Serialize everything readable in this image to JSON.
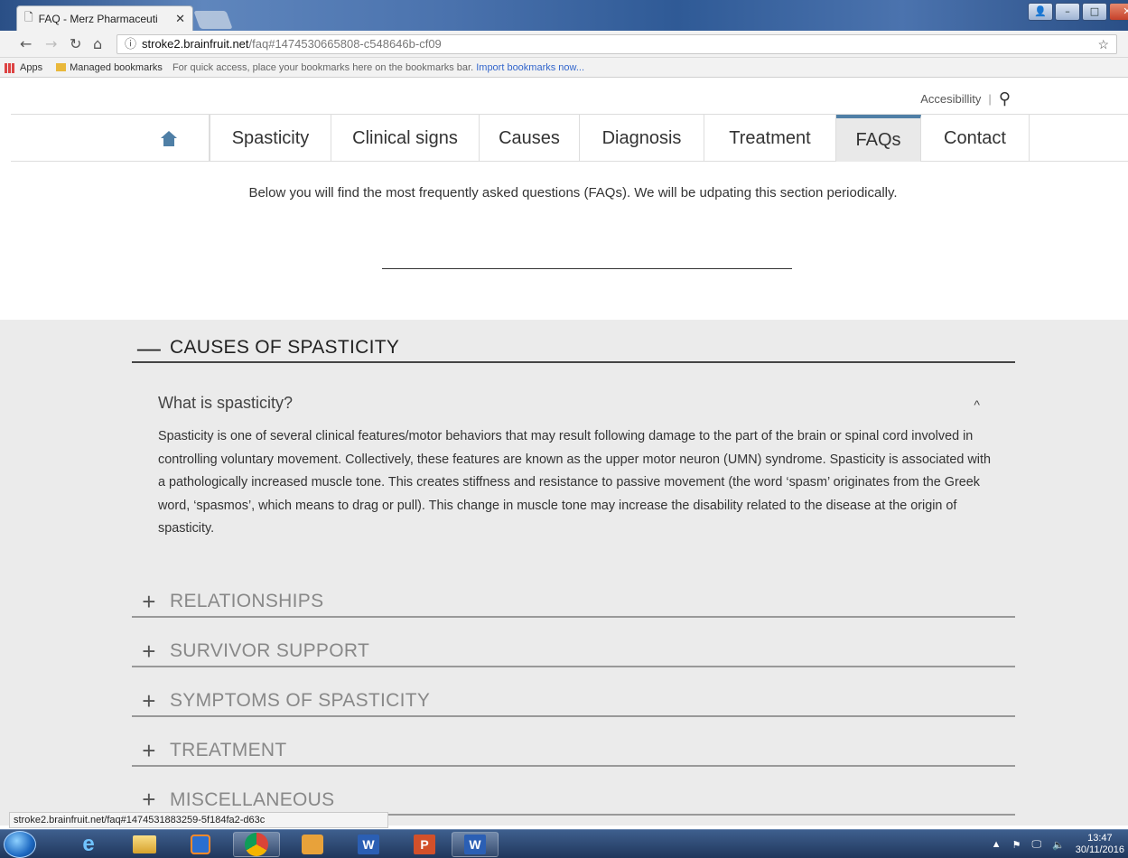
{
  "browser": {
    "tab_title": "FAQ - Merz Pharmaceuti",
    "tab_close": "✕",
    "url_host": "stroke2.brainfruit.net",
    "url_path": "/faq#1474530665808-c548646b-cf09",
    "bookmarks": {
      "apps": "Apps",
      "managed": "Managed bookmarks",
      "hint": "For quick access, place your bookmarks here on the bookmarks bar.",
      "import": "Import bookmarks now..."
    }
  },
  "utility": {
    "accessibility": "Accesibillity",
    "separator": "|"
  },
  "nav": {
    "items": [
      {
        "label": "Spasticity"
      },
      {
        "label": "Clinical signs"
      },
      {
        "label": "Causes"
      },
      {
        "label": "Diagnosis"
      },
      {
        "label": "Treatment"
      },
      {
        "label": "FAQs"
      },
      {
        "label": "Contact"
      }
    ],
    "active_color": "#4f7fa6"
  },
  "intro": "Below you will find the most frequently asked questions (FAQs). We will be udpating this section periodically.",
  "faq": {
    "sections": [
      {
        "sign": "—",
        "title": "CAUSES OF SPASTICITY"
      },
      {
        "sign": "+",
        "title": "RELATIONSHIPS"
      },
      {
        "sign": "+",
        "title": "SURVIVOR SUPPORT"
      },
      {
        "sign": "+",
        "title": "SYMPTOMS OF SPASTICITY"
      },
      {
        "sign": "+",
        "title": "TREATMENT"
      },
      {
        "sign": "+",
        "title": "MISCELLANEOUS"
      }
    ],
    "question": "What is spasticity?",
    "answer": "Spasticity is one of several clinical features/motor behaviors that may result following damage to the part of the brain or spinal cord involved in controlling voluntary movement. Collectively, these features are known as the upper motor neuron (UMN) syndrome. Spasticity is associated with a pathologically increased muscle tone. This creates stiffness and resistance to passive movement (the word ‘spasm’ originates from the Greek word, ‘spasmos’, which means to drag or pull). This change in muscle tone may increase the disability related to the disease at the origin of spasticity."
  },
  "status_url": "stroke2.brainfruit.net/faq#1474531883259-5f184fa2-d63c",
  "taskbar": {
    "time": "13:47",
    "date": "30/11/2016",
    "apps": [
      "ie-icon",
      "explorer-icon",
      "media-player-icon",
      "chrome-icon",
      "outlook-icon",
      "word-icon",
      "powerpoint-icon",
      "word-icon"
    ]
  }
}
